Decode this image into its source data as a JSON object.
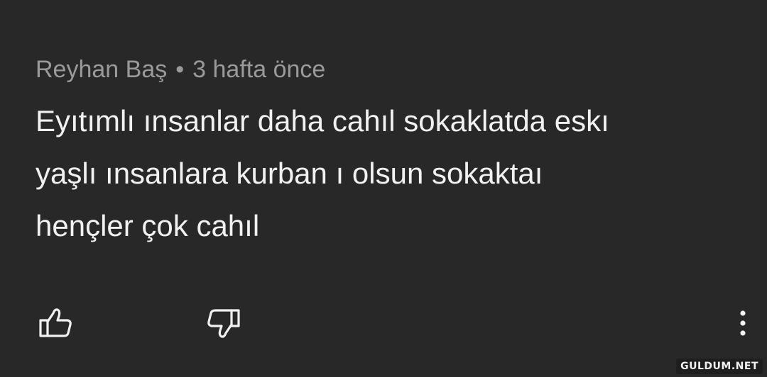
{
  "comment": {
    "author": "Reyhan Baş",
    "separator": "•",
    "time": "3 hafta önce",
    "lines": [
      "Eyıtımlı ınsanlar daha cahıl sokaklatda eskı",
      "yaşlı ınsanlara kurban ı olsun sokaktaı",
      "hençler çok cahıl"
    ]
  },
  "actions": {
    "like_icon": "thumbs-up-icon",
    "dislike_icon": "thumbs-down-icon",
    "more_icon": "more-vertical-icon"
  },
  "watermark": "GULDUM.NET",
  "colors": {
    "background": "#282828",
    "meta_text": "#9a9a9a",
    "body_text": "#f1f1f1",
    "icon": "#f1f1f1"
  }
}
